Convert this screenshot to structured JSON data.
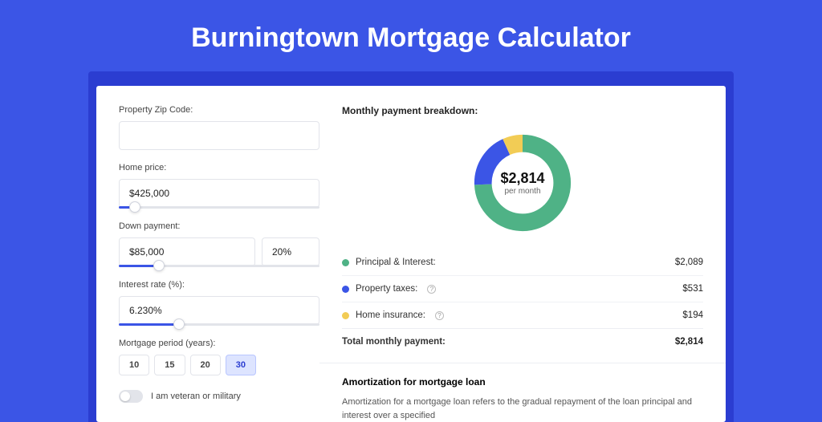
{
  "title": "Burningtown Mortgage Calculator",
  "form": {
    "zip_label": "Property Zip Code:",
    "zip_value": "",
    "home_price_label": "Home price:",
    "home_price_value": "$425,000",
    "home_price_slider_pct": 8,
    "down_payment_label": "Down payment:",
    "down_payment_value": "$85,000",
    "down_payment_pct": "20%",
    "down_payment_slider_pct": 20,
    "interest_label": "Interest rate (%):",
    "interest_value": "6.230%",
    "interest_slider_pct": 30,
    "period_label": "Mortgage period (years):",
    "periods": [
      "10",
      "15",
      "20",
      "30"
    ],
    "period_selected_index": 3,
    "veteran_label": "I am veteran or military",
    "veteran_on": false
  },
  "breakdown": {
    "title": "Monthly payment breakdown:",
    "center_amount": "$2,814",
    "center_sub": "per month",
    "rows": [
      {
        "label": "Principal & Interest:",
        "value": "$2,089",
        "color": "#4fb286",
        "info": false
      },
      {
        "label": "Property taxes:",
        "value": "$531",
        "color": "#3b55e6",
        "info": true
      },
      {
        "label": "Home insurance:",
        "value": "$194",
        "color": "#f2cc55",
        "info": true
      }
    ],
    "total_label": "Total monthly payment:",
    "total_value": "$2,814"
  },
  "amortization": {
    "title": "Amortization for mortgage loan",
    "text": "Amortization for a mortgage loan refers to the gradual repayment of the loan principal and interest over a specified"
  },
  "chart_data": {
    "type": "pie",
    "title": "Monthly payment breakdown",
    "series": [
      {
        "name": "Principal & Interest",
        "value": 2089,
        "color": "#4fb286"
      },
      {
        "name": "Property taxes",
        "value": 531,
        "color": "#3b55e6"
      },
      {
        "name": "Home insurance",
        "value": 194,
        "color": "#f2cc55"
      }
    ],
    "total": 2814,
    "center_label": "$2,814 per month"
  }
}
